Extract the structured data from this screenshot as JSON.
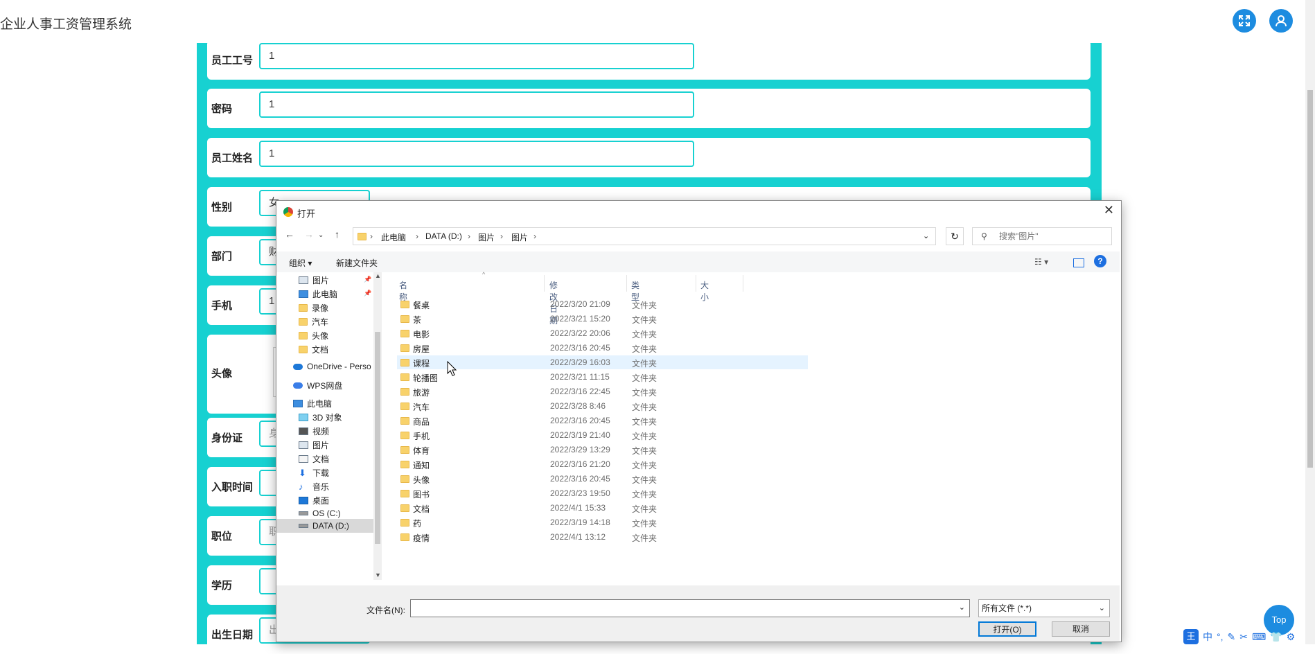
{
  "app": {
    "title": "企业人事工资管理系统"
  },
  "header": {
    "fullscreen_icon": "expand-icon",
    "user_icon": "user-icon"
  },
  "form": {
    "fields": [
      {
        "label": "员工工号",
        "value": "1"
      },
      {
        "label": "密码",
        "value": "1"
      },
      {
        "label": "员工姓名",
        "value": "1"
      },
      {
        "label": "性别",
        "value": "女"
      },
      {
        "label": "部门",
        "value": "财"
      },
      {
        "label": "手机",
        "value": "1"
      },
      {
        "label": "头像",
        "value": ""
      },
      {
        "label": "身份证",
        "placeholder": "身"
      },
      {
        "label": "入职时间",
        "value": ""
      },
      {
        "label": "职位",
        "placeholder": "职"
      },
      {
        "label": "学历",
        "value": ""
      },
      {
        "label": "出生日期",
        "placeholder": "出"
      }
    ]
  },
  "dialog": {
    "title": "打开",
    "breadcrumb": [
      "此电脑",
      "DATA (D:)",
      "图片",
      "图片"
    ],
    "search_placeholder": "搜索\"图片\"",
    "toolbar": {
      "organize": "组织 ▾",
      "new_folder": "新建文件夹"
    },
    "tree": [
      {
        "label": "图片",
        "icon": "pictures-icon",
        "pinned": true
      },
      {
        "label": "此电脑",
        "icon": "computer-icon",
        "pinned": true
      },
      {
        "label": "录像",
        "icon": "folder-icon"
      },
      {
        "label": "汽车",
        "icon": "folder-icon"
      },
      {
        "label": "头像",
        "icon": "folder-icon"
      },
      {
        "label": "文档",
        "icon": "folder-icon"
      },
      {
        "label": "OneDrive - Perso",
        "icon": "onedrive-icon"
      },
      {
        "label": "WPS网盘",
        "icon": "wps-cloud-icon"
      },
      {
        "label": "此电脑",
        "icon": "computer-icon"
      },
      {
        "label": "3D 对象",
        "icon": "3d-objects-icon"
      },
      {
        "label": "视频",
        "icon": "videos-icon"
      },
      {
        "label": "图片",
        "icon": "pictures-icon"
      },
      {
        "label": "文档",
        "icon": "documents-icon"
      },
      {
        "label": "下载",
        "icon": "download-icon"
      },
      {
        "label": "音乐",
        "icon": "music-icon"
      },
      {
        "label": "桌面",
        "icon": "desktop-icon"
      },
      {
        "label": "OS (C:)",
        "icon": "drive-icon"
      },
      {
        "label": "DATA (D:)",
        "icon": "drive-icon"
      }
    ],
    "columns": {
      "name": "名称",
      "date": "修改日期",
      "type": "类型",
      "size": "大小"
    },
    "files": [
      {
        "name": "餐桌",
        "date": "2022/3/20 21:09",
        "type": "文件夹"
      },
      {
        "name": "茶",
        "date": "2022/3/21 15:20",
        "type": "文件夹"
      },
      {
        "name": "电影",
        "date": "2022/3/22 20:06",
        "type": "文件夹"
      },
      {
        "name": "房屋",
        "date": "2022/3/16 20:45",
        "type": "文件夹"
      },
      {
        "name": "课程",
        "date": "2022/3/29 16:03",
        "type": "文件夹"
      },
      {
        "name": "轮播图",
        "date": "2022/3/21 11:15",
        "type": "文件夹"
      },
      {
        "name": "旅游",
        "date": "2022/3/16 22:45",
        "type": "文件夹"
      },
      {
        "name": "汽车",
        "date": "2022/3/28 8:46",
        "type": "文件夹"
      },
      {
        "name": "商品",
        "date": "2022/3/16 20:45",
        "type": "文件夹"
      },
      {
        "name": "手机",
        "date": "2022/3/19 21:40",
        "type": "文件夹"
      },
      {
        "name": "体育",
        "date": "2022/3/29 13:29",
        "type": "文件夹"
      },
      {
        "name": "通知",
        "date": "2022/3/16 21:20",
        "type": "文件夹"
      },
      {
        "name": "头像",
        "date": "2022/3/16 20:45",
        "type": "文件夹"
      },
      {
        "name": "图书",
        "date": "2022/3/23 19:50",
        "type": "文件夹"
      },
      {
        "name": "文档",
        "date": "2022/4/1 15:33",
        "type": "文件夹"
      },
      {
        "name": "药",
        "date": "2022/3/19 14:18",
        "type": "文件夹"
      },
      {
        "name": "疫情",
        "date": "2022/4/1 13:12",
        "type": "文件夹"
      }
    ],
    "selected_index": 4,
    "filename_label": "文件名(N):",
    "filename_value": "",
    "filetype": "所有文件 (*.*)",
    "open_button": "打开(O)",
    "cancel_button": "取消"
  },
  "top_button": "Top",
  "ime": {
    "logo": "王",
    "mode": "中"
  },
  "colors": {
    "accent": "#17d1d1",
    "primary": "#1d8ce0",
    "selection": "#e5f3ff"
  }
}
